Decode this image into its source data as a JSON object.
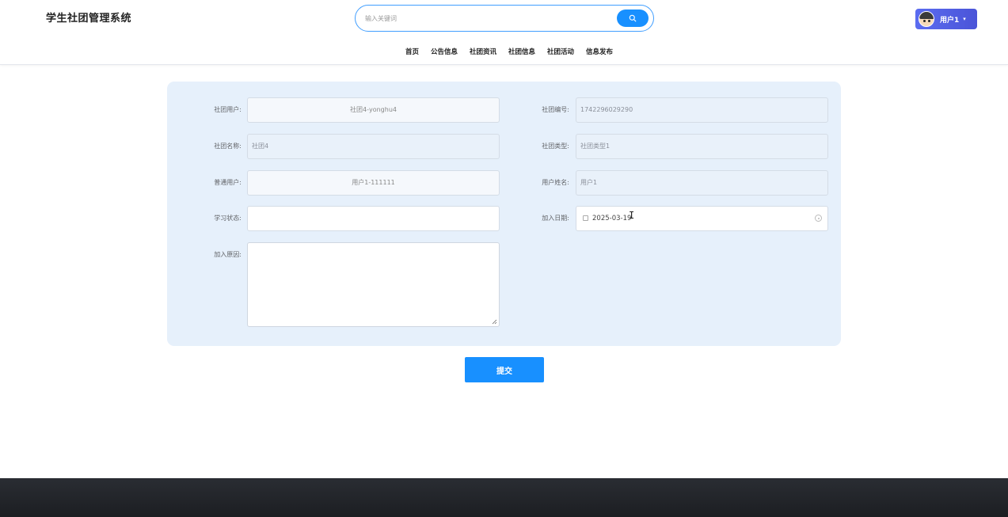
{
  "header": {
    "site_title": "学生社团管理系统",
    "search": {
      "placeholder": "输入关键词",
      "value": ""
    },
    "user_label": "用户1"
  },
  "nav": {
    "items": [
      "首页",
      "公告信息",
      "社团资讯",
      "社团信息",
      "社团活动",
      "信息发布"
    ]
  },
  "form": {
    "club_user": {
      "label": "社团用户:",
      "value": "社团4-yonghu4"
    },
    "club_no": {
      "label": "社团编号:",
      "value": "1742296029290"
    },
    "club_name": {
      "label": "社团名称:",
      "value": "社团4"
    },
    "club_type": {
      "label": "社团类型:",
      "value": "社团类型1"
    },
    "normal_user": {
      "label": "普通用户:",
      "value": "用户1-111111"
    },
    "user_name": {
      "label": "用户姓名:",
      "value": "用户1"
    },
    "study_status": {
      "label": "学习状态:",
      "value": ""
    },
    "join_date": {
      "label": "加入日期:",
      "value": "2025-03-19"
    },
    "join_reason": {
      "label": "加入原因:",
      "value": ""
    }
  },
  "submit_label": "提交",
  "colors": {
    "accent": "#1890ff",
    "form_bg": "#e6f0fb",
    "user_btn": "#5b6cf0",
    "footer": "#1f2126"
  }
}
